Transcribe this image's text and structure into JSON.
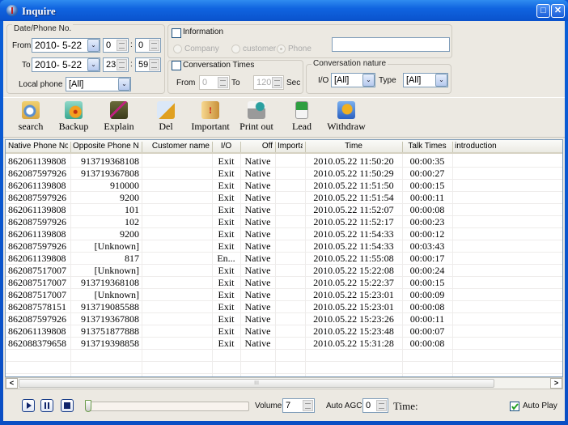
{
  "window": {
    "title": "Inquire",
    "maximize_label": "□",
    "close_label": "✕"
  },
  "date_phone": {
    "group_label": "Date/Phone No.",
    "from_label": "From",
    "to_label": "To",
    "from_date": "2010-  5-22",
    "from_hour": "0",
    "from_minute": "0",
    "to_date": "2010-  5-22",
    "to_hour": "23",
    "to_minute": "59",
    "colon": ":",
    "local_phone_label": "Local phone",
    "local_phone_value": "[All]"
  },
  "information": {
    "label": "Information",
    "checked": false,
    "options": [
      "Company",
      "customer",
      "Phone"
    ],
    "selected": "Phone",
    "search_value": ""
  },
  "conversation_times": {
    "label": "Conversation Times",
    "checked": false,
    "from_label": "From",
    "from_value": "0",
    "to_label": "To",
    "to_value": "120",
    "unit": "Sec"
  },
  "conversation_nature": {
    "label": "Conversation nature",
    "io_label": "I/O",
    "io_value": "[All]",
    "type_label": "Type",
    "type_value": "[All]"
  },
  "toolbar": {
    "search": "search",
    "backup": "Backup",
    "explain": "Explain",
    "del": "Del",
    "important": "Important",
    "print": "Print out",
    "lead": "Lead",
    "withdraw": "Withdraw"
  },
  "table": {
    "columns": [
      "Native Phone No.",
      "Opposite Phone No.",
      "Customer name",
      "I/O",
      "Off",
      "Importan",
      "Time",
      "Talk Times",
      "introduction"
    ],
    "rows": [
      [
        "862061139808",
        "913719368108",
        "",
        "Exit",
        "Native",
        "",
        "2010.05.22 11:50:20",
        "00:00:35",
        ""
      ],
      [
        "862087597926",
        "913719367808",
        "",
        "Exit",
        "Native",
        "",
        "2010.05.22 11:50:29",
        "00:00:27",
        ""
      ],
      [
        "862061139808",
        "910000",
        "",
        "Exit",
        "Native",
        "",
        "2010.05.22 11:51:50",
        "00:00:15",
        ""
      ],
      [
        "862087597926",
        "9200",
        "",
        "Exit",
        "Native",
        "",
        "2010.05.22 11:51:54",
        "00:00:11",
        ""
      ],
      [
        "862061139808",
        "101",
        "",
        "Exit",
        "Native",
        "",
        "2010.05.22 11:52:07",
        "00:00:08",
        ""
      ],
      [
        "862087597926",
        "102",
        "",
        "Exit",
        "Native",
        "",
        "2010.05.22 11:52:17",
        "00:00:23",
        ""
      ],
      [
        "862061139808",
        "9200",
        "",
        "Exit",
        "Native",
        "",
        "2010.05.22 11:54:33",
        "00:00:12",
        ""
      ],
      [
        "862087597926",
        "[Unknown]",
        "",
        "Exit",
        "Native",
        "",
        "2010.05.22 11:54:33",
        "00:03:43",
        ""
      ],
      [
        "862061139808",
        "817",
        "",
        "En...",
        "Native",
        "",
        "2010.05.22 11:55:08",
        "00:00:17",
        ""
      ],
      [
        "862087517007",
        "[Unknown]",
        "",
        "Exit",
        "Native",
        "",
        "2010.05.22 15:22:08",
        "00:00:24",
        ""
      ],
      [
        "862087517007",
        "913719368108",
        "",
        "Exit",
        "Native",
        "",
        "2010.05.22 15:22:37",
        "00:00:15",
        ""
      ],
      [
        "862087517007",
        "[Unknown]",
        "",
        "Exit",
        "Native",
        "",
        "2010.05.22 15:23:01",
        "00:00:09",
        ""
      ],
      [
        "862087578151",
        "913719085588",
        "",
        "Exit",
        "Native",
        "",
        "2010.05.22 15:23:01",
        "00:00:08",
        ""
      ],
      [
        "862087597926",
        "913719367808",
        "",
        "Exit",
        "Native",
        "",
        "2010.05.22 15:23:26",
        "00:00:11",
        ""
      ],
      [
        "862061139808",
        "913751877888",
        "",
        "Exit",
        "Native",
        "",
        "2010.05.22 15:23:48",
        "00:00:07",
        ""
      ],
      [
        "862088379658",
        "913719398858",
        "",
        "Exit",
        "Native",
        "",
        "2010.05.22 15:31:28",
        "00:00:08",
        ""
      ]
    ]
  },
  "scrollbar": {
    "left": "<",
    "right": ">",
    "grip": "III"
  },
  "player": {
    "volume_label": "Volume",
    "volume_value": "7",
    "agc_label": "Auto AGC",
    "agc_value": "0",
    "time_label": "Time:",
    "autoplay_label": "Auto Play",
    "autoplay_checked": true,
    "position_fraction": 0
  }
}
